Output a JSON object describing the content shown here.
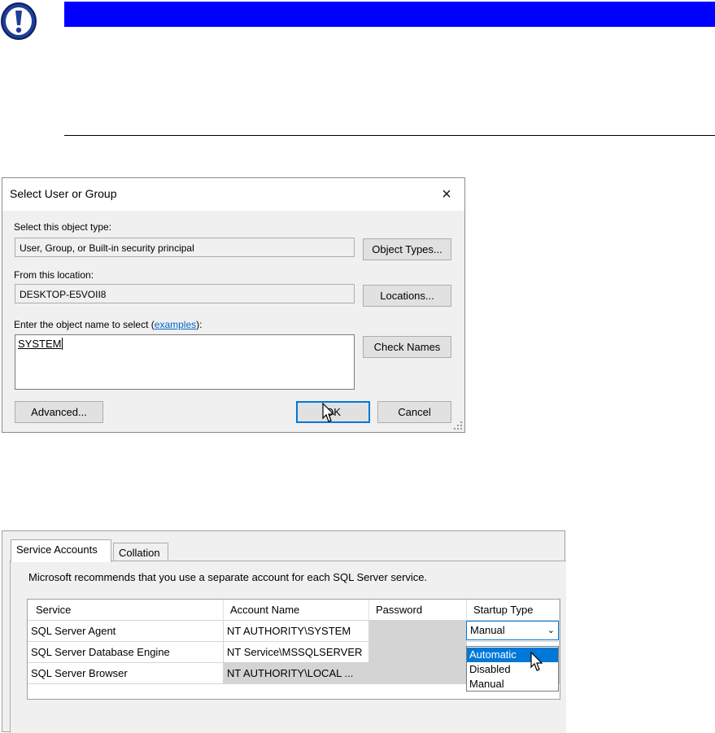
{
  "notice": {
    "icon": "exclamation-icon",
    "accent": "#0000ff"
  },
  "select_dialog": {
    "title": "Select User or Group",
    "close_icon": "×",
    "object_type_label": "Select this object type:",
    "object_type_value": "User, Group, or Built-in security principal",
    "object_types_button": "Object Types...",
    "location_label": "From this location:",
    "location_value": "DESKTOP-E5VOII8",
    "locations_button": "Locations...",
    "object_name_label_prefix": "Enter the object name to select (",
    "object_name_link": "examples",
    "object_name_label_suffix": "):",
    "object_name_value": "SYSTEM",
    "check_names_button": "Check Names",
    "advanced_button": "Advanced...",
    "ok_button": "OK",
    "cancel_button": "Cancel"
  },
  "service_accounts": {
    "tabs": [
      "Service Accounts",
      "Collation"
    ],
    "note": "Microsoft recommends that you use a separate account for each SQL Server service.",
    "columns": [
      "Service",
      "Account Name",
      "Password",
      "Startup Type"
    ],
    "rows": [
      {
        "service": "SQL Server Agent",
        "account": "NT AUTHORITY\\SYSTEM",
        "password": "",
        "startup": "Manual"
      },
      {
        "service": "SQL Server Database Engine",
        "account": "NT Service\\MSSQLSERVER",
        "password": "",
        "startup": ""
      },
      {
        "service": "SQL Server Browser",
        "account": "NT AUTHORITY\\LOCAL ...",
        "password": "",
        "startup": ""
      }
    ],
    "startup_options": [
      "Automatic",
      "Disabled",
      "Manual"
    ],
    "startup_highlighted": "Automatic",
    "combo_arrow": "⌄",
    "selected_accent": "#0078d7"
  }
}
